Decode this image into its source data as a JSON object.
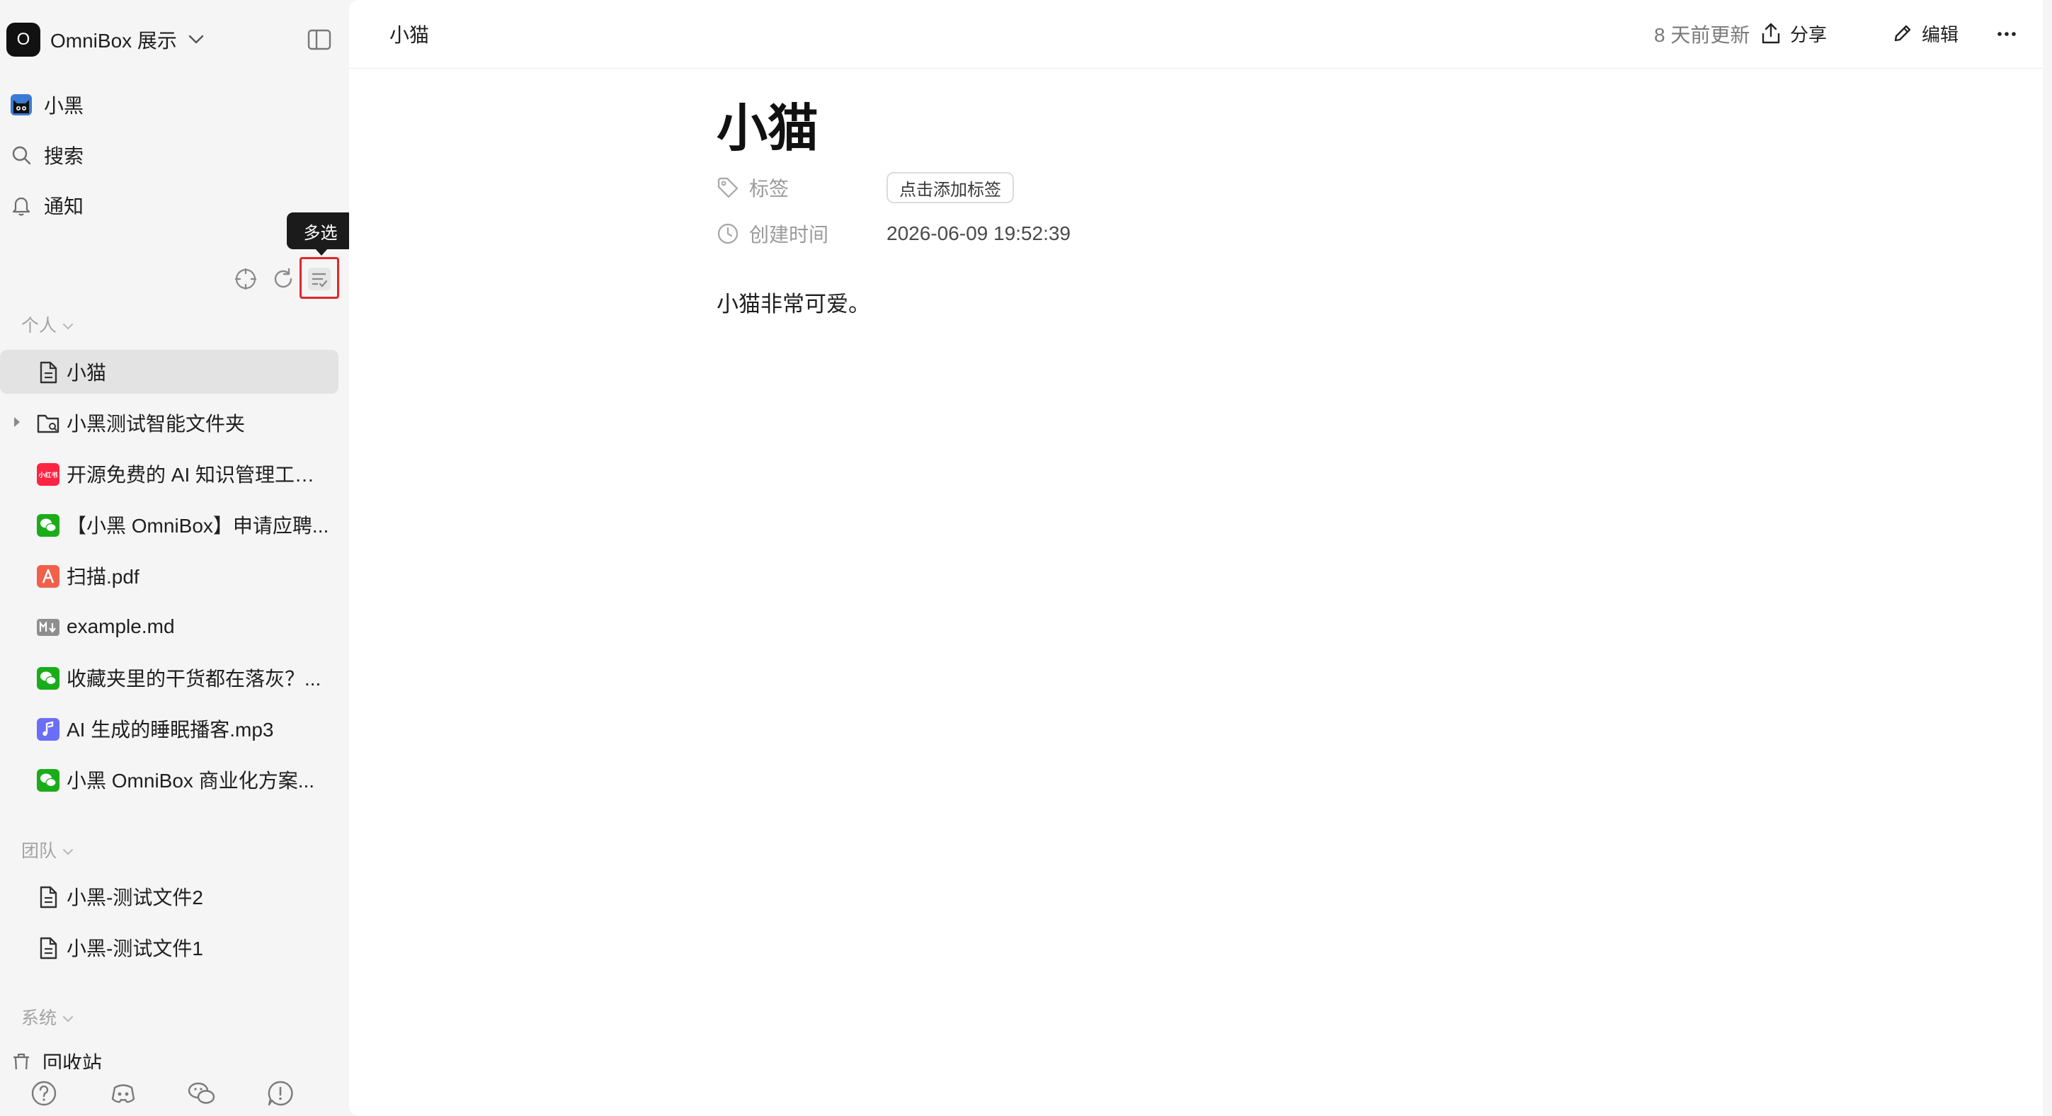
{
  "workspace": {
    "logo_letter": "O",
    "name": "OmniBox 展示"
  },
  "nav": [
    {
      "label": "小黑",
      "icon": "cat-avatar-icon"
    },
    {
      "label": "搜索",
      "icon": "search-icon"
    },
    {
      "label": "通知",
      "icon": "bell-icon"
    }
  ],
  "toolbar": {
    "tooltip": "多选",
    "locate_icon": "crosshair-icon",
    "refresh_icon": "refresh-icon",
    "multiselect_icon": "multiselect-icon"
  },
  "sections": {
    "personal": "个人",
    "team": "团队",
    "system": "系统"
  },
  "personal_items": [
    {
      "label": "小猫",
      "icon": "doc-icon",
      "active": true
    },
    {
      "label": "小黑测试智能文件夹",
      "icon": "smart-folder-icon"
    },
    {
      "label": "开源免费的 AI 知识管理工具，支持...",
      "icon": "xiaohongshu-icon"
    },
    {
      "label": "【小黑 OmniBox】申请应聘...",
      "icon": "wechat-icon"
    },
    {
      "label": "扫描.pdf",
      "icon": "pdf-icon"
    },
    {
      "label": "example.md",
      "icon": "markdown-icon"
    },
    {
      "label": "收藏夹里的干货都在落灰？...",
      "icon": "wechat-icon"
    },
    {
      "label": "AI 生成的睡眠播客.mp3",
      "icon": "audio-icon"
    },
    {
      "label": "小黑 OmniBox 商业化方案...",
      "icon": "wechat-icon"
    }
  ],
  "team_items": [
    {
      "label": "小黑-测试文件2",
      "icon": "doc-icon"
    },
    {
      "label": "小黑-测试文件1",
      "icon": "doc-icon"
    }
  ],
  "system_items": [
    {
      "label": "回收站",
      "icon": "trash-icon"
    }
  ],
  "footer_icons": [
    "help-icon",
    "discord-icon",
    "wechat-icon",
    "feedback-icon"
  ],
  "header": {
    "breadcrumb": "小猫",
    "updated": "8 天前更新",
    "share_label": "分享",
    "edit_label": "编辑"
  },
  "document": {
    "title": "小猫",
    "tags_key": "标签",
    "add_tag": "点击添加标签",
    "created_key": "创建时间",
    "created_value": "2026-06-09 19:52:39",
    "body": "小猫非常可爱。"
  },
  "colors": {
    "accent_red": "#e5252a",
    "xiaohongshu": "#ff2442",
    "wechat": "#1aad19",
    "pdf": "#f0604a",
    "audio": "#6b6ef6",
    "markdown": "#8e8e8e"
  }
}
